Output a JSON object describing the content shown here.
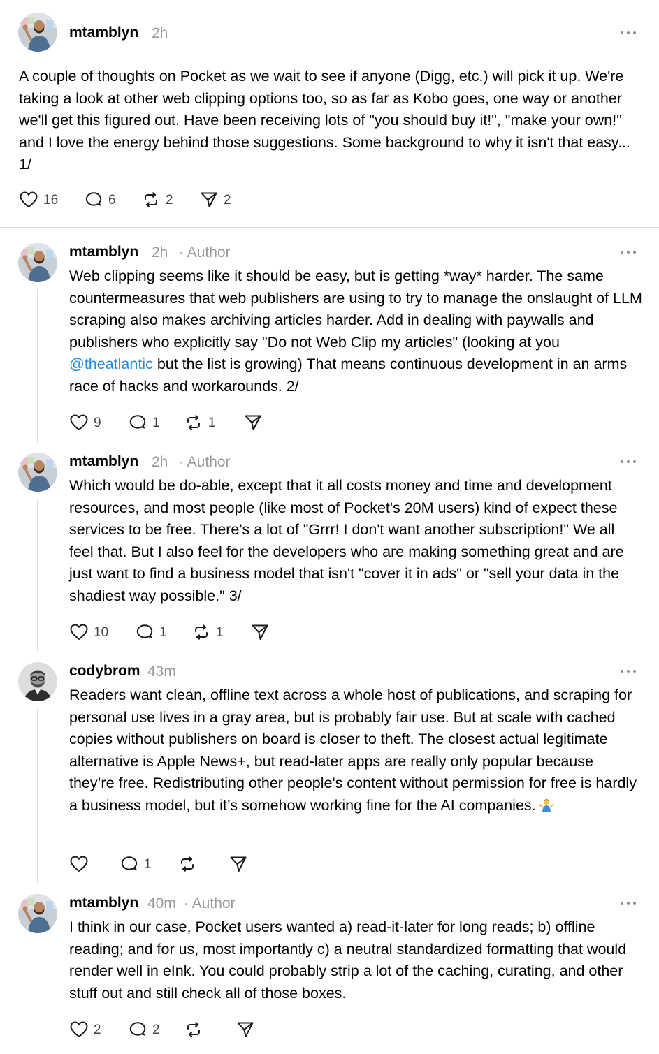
{
  "posts": [
    {
      "username": "mtamblyn",
      "time": "2h",
      "author_tag": "",
      "text": "A couple of thoughts on Pocket as we wait to see if anyone (Digg, etc.) will pick it up. We're taking a look at other web clipping options too, so as far as Kobo goes, one way or another we'll get this figured out. Have been receiving lots of \"you should buy it!\", \"make your own!\" and I love the energy behind those suggestions. Some background to why it isn't that easy... 1/",
      "likes": "16",
      "replies": "6",
      "reposts": "2",
      "shares": "2"
    },
    {
      "username": "mtamblyn",
      "time": "2h",
      "author_tag": "· Author",
      "text_before": "Web clipping seems like it should be easy, but is getting *way* harder. The same countermeasures that web publishers are using to try to manage the onslaught of LLM scraping also makes archiving articles harder. Add in dealing with paywalls and publishers who explicitly say \"Do not Web Clip my articles\" (looking at you ",
      "mention": "@theatlantic",
      "text_after": " but the list is growing) That means continuous development in an arms race of hacks and workarounds. 2/",
      "likes": "9",
      "replies": "1",
      "reposts": "1",
      "shares": ""
    },
    {
      "username": "mtamblyn",
      "time": "2h",
      "author_tag": "· Author",
      "text": "Which would be do-able, except that it all costs money and time and development resources, and most people (like most of Pocket's 20M users) kind of expect these services to be free. There's a lot of \"Grrr! I don't want another subscription!\" We all feel that. But I also feel for the developers who are making something great and are just want to find a business model that isn't \"cover it in ads\" or \"sell your data in the shadiest way possible.\" 3/",
      "likes": "10",
      "replies": "1",
      "reposts": "1",
      "shares": ""
    },
    {
      "username": "codybrom",
      "time": "43m",
      "author_tag": "",
      "text": "Readers want clean, offline text across a whole host of publications, and scraping for personal use lives in a gray area, but is probably fair use. But at scale with cached copies without publishers on board is closer to theft. The closest actual legitimate alternative is Apple News+, but read-later apps are really only popular because they’re free. Redistributing other people's content without permission for free is hardly a business model, but it’s somehow working fine for the AI companies.",
      "emoji": "person-shrugging-emoji",
      "likes": "",
      "replies": "1",
      "reposts": "",
      "shares": ""
    },
    {
      "username": "mtamblyn",
      "time": "40m",
      "author_tag": "· Author",
      "text": "I think in our case, Pocket users wanted a) read-it-later for long reads; b) offline reading; and for us, most importantly c) a neutral standardized formatting that would render well in eInk. You could probably strip a lot of the caching, curating, and other stuff out and still check all of those boxes.",
      "likes": "2",
      "replies": "2",
      "reposts": "",
      "shares": ""
    }
  ],
  "icons": {
    "more": "more-options-icon",
    "like": "heart-icon",
    "reply": "comment-icon",
    "repost": "repost-icon",
    "share": "share-icon"
  },
  "colors": {
    "mention": "#1d8ce0",
    "meta": "#999999",
    "thread_line": "#e0e0e0"
  }
}
